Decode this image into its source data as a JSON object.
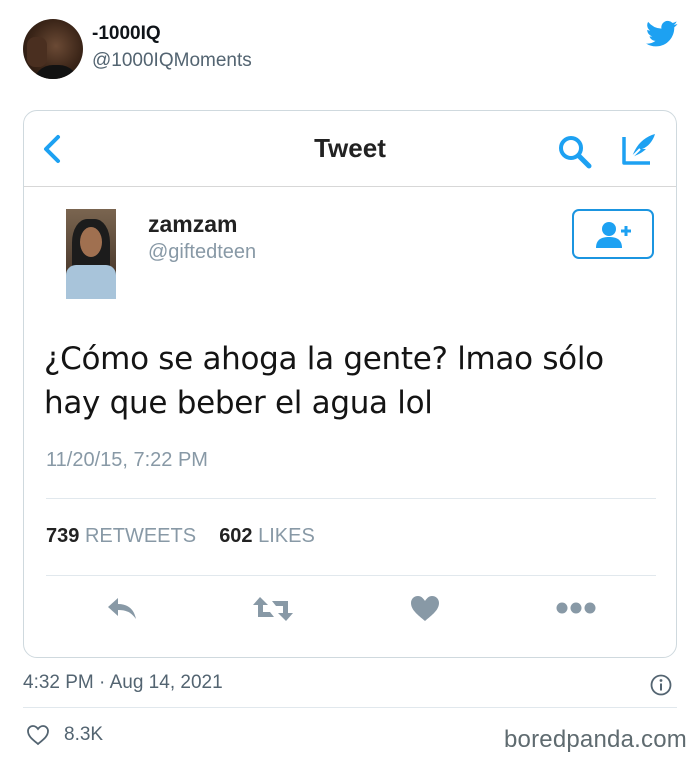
{
  "outer": {
    "display_name": "-1000IQ",
    "handle": "@1000IQMoments",
    "posted_time": "4:32 PM · Aug 14, 2021",
    "like_count": "8.3K"
  },
  "card": {
    "header_title": "Tweet",
    "author_name": "zamzam",
    "author_handle": "@giftedteen",
    "tweet_text": "¿Cómo se ahoga la gente? lmao sólo hay que beber el agua lol",
    "timestamp": "11/20/15, 7:22 PM",
    "retweets_count": "739",
    "retweets_label": "RETWEETS",
    "likes_count": "602",
    "likes_label": "LIKES"
  },
  "watermark": "boredpanda.com",
  "icons": {
    "brand": "bird-icon",
    "back": "chevron-left-icon",
    "search": "search-icon",
    "compose": "compose-icon",
    "follow": "add-user-icon",
    "reply": "reply-icon",
    "retweet": "retweet-icon",
    "like": "heart-icon",
    "more": "more-icon",
    "info": "info-icon"
  },
  "colors": {
    "twitter_blue": "#1da1f2",
    "muted_gray": "#8899a6",
    "secondary_text": "#536471"
  }
}
